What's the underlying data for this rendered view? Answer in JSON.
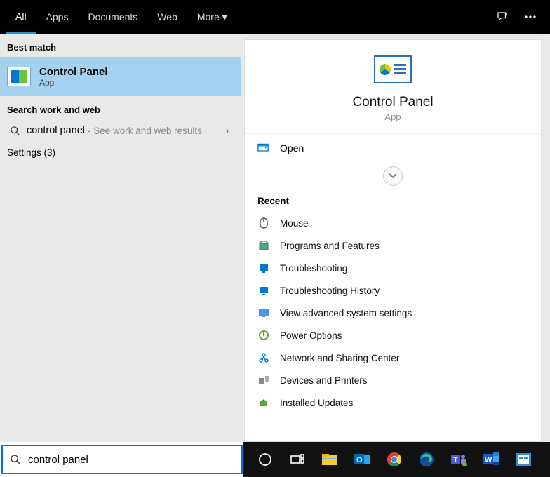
{
  "tabs": {
    "all": "All",
    "apps": "Apps",
    "documents": "Documents",
    "web": "Web",
    "more": "More"
  },
  "left": {
    "best_match_label": "Best match",
    "result": {
      "title": "Control Panel",
      "subtitle": "App"
    },
    "search_web_label": "Search work and web",
    "web_query": "control panel",
    "web_hint": "- See work and web results",
    "settings_label": "Settings (3)"
  },
  "preview": {
    "title": "Control Panel",
    "subtitle": "App",
    "open_label": "Open",
    "recent_label": "Recent",
    "recent": [
      "Mouse",
      "Programs and Features",
      "Troubleshooting",
      "Troubleshooting History",
      "View advanced system settings",
      "Power Options",
      "Network and Sharing Center",
      "Devices and Printers",
      "Installed Updates"
    ]
  },
  "search": {
    "value": "control panel"
  }
}
